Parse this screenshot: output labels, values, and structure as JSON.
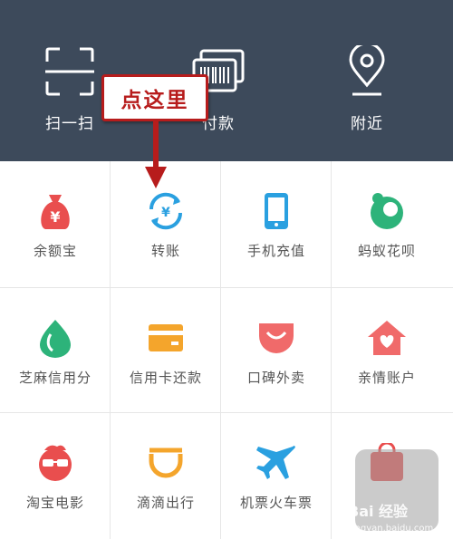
{
  "top": {
    "items": [
      {
        "label": "扫一扫",
        "icon": "scan-icon"
      },
      {
        "label": "付款",
        "icon": "barcode-pay-icon"
      },
      {
        "label": "附近",
        "icon": "location-pin-icon"
      }
    ]
  },
  "grid": {
    "items": [
      {
        "label": "余额宝",
        "icon": "money-bag-icon",
        "color": "#e94e4e"
      },
      {
        "label": "转账",
        "icon": "transfer-icon",
        "color": "#2aa0e0"
      },
      {
        "label": "手机充值",
        "icon": "phone-icon",
        "color": "#2aa0e0"
      },
      {
        "label": "蚂蚁花呗",
        "icon": "huabei-icon",
        "color": "#2db37a"
      },
      {
        "label": "芝麻信用分",
        "icon": "sesame-credit-icon",
        "color": "#2db37a"
      },
      {
        "label": "信用卡还款",
        "icon": "credit-card-icon",
        "color": "#f4a52c"
      },
      {
        "label": "口碑外卖",
        "icon": "koubei-icon",
        "color": "#f06a6a"
      },
      {
        "label": "亲情账户",
        "icon": "family-house-icon",
        "color": "#f06a6a"
      },
      {
        "label": "淘宝电影",
        "icon": "taobao-movie-icon",
        "color": "#e94e4e"
      },
      {
        "label": "滴滴出行",
        "icon": "didi-icon",
        "color": "#f4a52c"
      },
      {
        "label": "机票火车票",
        "icon": "airplane-icon",
        "color": "#2aa0e0"
      },
      {
        "label": "",
        "icon": "shopping-bag-icon",
        "color": "#e94e4e"
      }
    ]
  },
  "annotation": {
    "text": "点这里"
  },
  "watermark": {
    "text": "Bai 经验",
    "sub": "jingyan.baidu.com"
  }
}
